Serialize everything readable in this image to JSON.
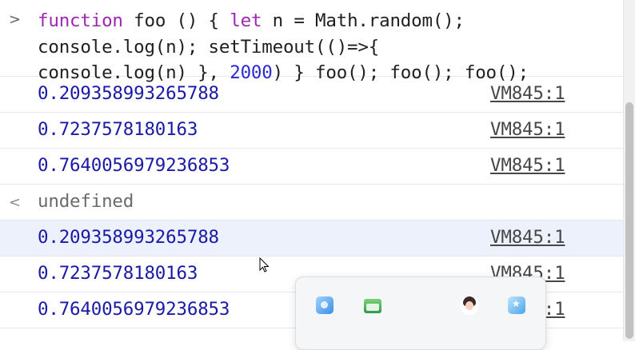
{
  "console": {
    "prompt_symbol": ">",
    "return_symbol": "<",
    "input": {
      "line1": {
        "kw1": "function",
        "t1": " foo () { ",
        "kw2": "let",
        "t2": " n = Math.random();"
      },
      "line2": "console.log(n); setTimeout(()=>{",
      "line3": {
        "t1": "console.log(n) }, ",
        "num": "2000",
        "t2": ") } foo(); foo(); foo();"
      }
    },
    "logs_first": [
      {
        "value": "0.209358993265788",
        "source": "VM845:1"
      },
      {
        "value": "0.7237578180163",
        "source": "VM845:1"
      },
      {
        "value": "0.7640056979236853",
        "source": "VM845:1"
      }
    ],
    "return_value": "undefined",
    "logs_second": [
      {
        "value": "0.209358993265788",
        "source": "VM845:1"
      },
      {
        "value": "0.7237578180163",
        "source": "VM845:1"
      },
      {
        "value": "0.7640056979236853",
        "source": "VM845:1"
      }
    ],
    "colors": {
      "keyword": "#9c27b0",
      "number": "#2a2ad0",
      "log_value": "#1a1aa6",
      "highlight_row": "#edf1fb"
    }
  },
  "taskbar_popup": {
    "icons": [
      "app-icon-blue",
      "app-icon-green-folder",
      "avatar-icon",
      "app-icon-star"
    ]
  }
}
